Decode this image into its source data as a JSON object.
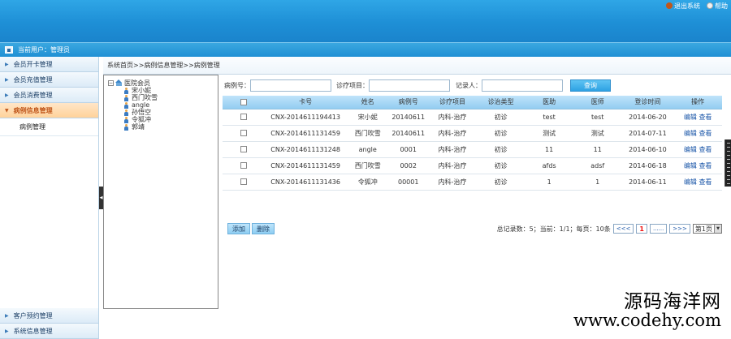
{
  "header": {
    "links": [
      {
        "label": "退出系统",
        "icon": "exit-icon",
        "color": "#c0561a"
      },
      {
        "label": "帮助",
        "icon": "help-icon",
        "color": "#f2f2f2"
      }
    ],
    "current_user": "当前用户：管理员"
  },
  "sidebar": {
    "items": [
      {
        "label": "会员开卡管理"
      },
      {
        "label": "会员充值管理"
      },
      {
        "label": "会员消费管理"
      },
      {
        "label": "病例信息管理",
        "active": true
      }
    ],
    "sub_items": [
      {
        "label": "病例管理"
      }
    ],
    "bottom_items": [
      {
        "label": "客户预约管理"
      },
      {
        "label": "系统信息管理"
      }
    ]
  },
  "breadcrumb": "系统首页>>病例信息管理>>病例管理",
  "tree": {
    "root": "医院会员",
    "members": [
      "宋小妮",
      "西门吹雪",
      "angle",
      "孙悟空",
      "令狐冲",
      "郭靖"
    ]
  },
  "search": {
    "case_no_label": "病例号：",
    "treatment_label": "诊疗项目：",
    "recorder_label": "记录人：",
    "query_button": "查询"
  },
  "table": {
    "columns": [
      "卡号",
      "姓名",
      "病例号",
      "诊疗项目",
      "诊治类型",
      "医助",
      "医师",
      "登诊时间",
      "操作"
    ],
    "rows": [
      {
        "card": "CNX-2014611194413",
        "name": "宋小妮",
        "case": "20140611",
        "item": "内科-治疗",
        "type": "初诊",
        "assistant": "test",
        "doctor": "test",
        "date": "2014-06-20"
      },
      {
        "card": "CNX-2014611131459",
        "name": "西门吹雪",
        "case": "20140611",
        "item": "内科-治疗",
        "type": "初诊",
        "assistant": "测试",
        "doctor": "测试",
        "date": "2014-07-11"
      },
      {
        "card": "CNX-2014611131248",
        "name": "angle",
        "case": "0001",
        "item": "内科-治疗",
        "type": "初诊",
        "assistant": "11",
        "doctor": "11",
        "date": "2014-06-10"
      },
      {
        "card": "CNX-2014611131459",
        "name": "西门吹雪",
        "case": "0002",
        "item": "内科-治疗",
        "type": "初诊",
        "assistant": "afds",
        "doctor": "adsf",
        "date": "2014-06-18"
      },
      {
        "card": "CNX-2014611131436",
        "name": "令狐冲",
        "case": "00001",
        "item": "内科-治疗",
        "type": "初诊",
        "assistant": "1",
        "doctor": "1",
        "date": "2014-06-11"
      }
    ],
    "action_edit": "编辑",
    "action_view": "查看"
  },
  "footer": {
    "add_button": "添加",
    "delete_button": "删除",
    "page_info": "总记录数：5；当前：1/1；每页：10条",
    "prev": "<<<",
    "current_page": "1",
    "ellipsis": "......",
    "next": ">>>",
    "page_select": "第1页"
  },
  "watermark": {
    "line1": "源码海洋网",
    "line2": "www.codehy.com"
  },
  "colors": {
    "accent": "#1e8fd6",
    "active_nav": "#ffd29a",
    "link": "#1a56a8"
  }
}
